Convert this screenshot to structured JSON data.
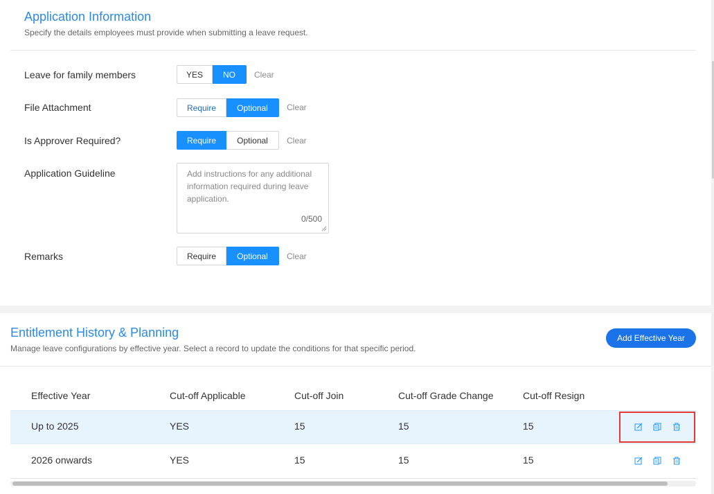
{
  "application_info": {
    "title": "Application Information",
    "subtitle": "Specify the details employees must provide when submitting a leave request.",
    "clear_label": "Clear",
    "rows": {
      "family": {
        "label": "Leave for family members",
        "options": [
          "YES",
          "NO"
        ],
        "selected": "NO"
      },
      "attachment": {
        "label": "File Attachment",
        "options": [
          "Require",
          "Optional"
        ],
        "selected": "Optional"
      },
      "approver": {
        "label": "Is Approver Required?",
        "options": [
          "Require",
          "Optional"
        ],
        "selected": "Require"
      },
      "guideline": {
        "label": "Application Guideline",
        "placeholder": "Add instructions for any additional information required during leave application.",
        "value": "",
        "counter": "0/500"
      },
      "remarks": {
        "label": "Remarks",
        "options": [
          "Require",
          "Optional"
        ],
        "selected": "Optional"
      }
    }
  },
  "entitlement": {
    "title": "Entitlement History & Planning",
    "subtitle": "Manage leave configurations by effective year. Select a record to update the conditions for that specific period.",
    "add_button": "Add Effective Year",
    "columns": [
      "Effective Year",
      "Cut-off Applicable",
      "Cut-off Join",
      "Cut-off Grade Change",
      "Cut-off Resign"
    ],
    "rows": [
      {
        "year": "Up to 2025",
        "applicable": "YES",
        "join": "15",
        "grade": "15",
        "resign": "15",
        "selected": true
      },
      {
        "year": "2026 onwards",
        "applicable": "YES",
        "join": "15",
        "grade": "15",
        "resign": "15",
        "selected": false
      }
    ],
    "row_actions": [
      "edit-icon",
      "copy-icon",
      "delete-icon"
    ]
  },
  "colors": {
    "accent": "#1890ff",
    "title": "#2d8ae6",
    "button": "#1a73e8",
    "highlight_row": "#e8f4fd",
    "annotation_box": "#e53935"
  }
}
